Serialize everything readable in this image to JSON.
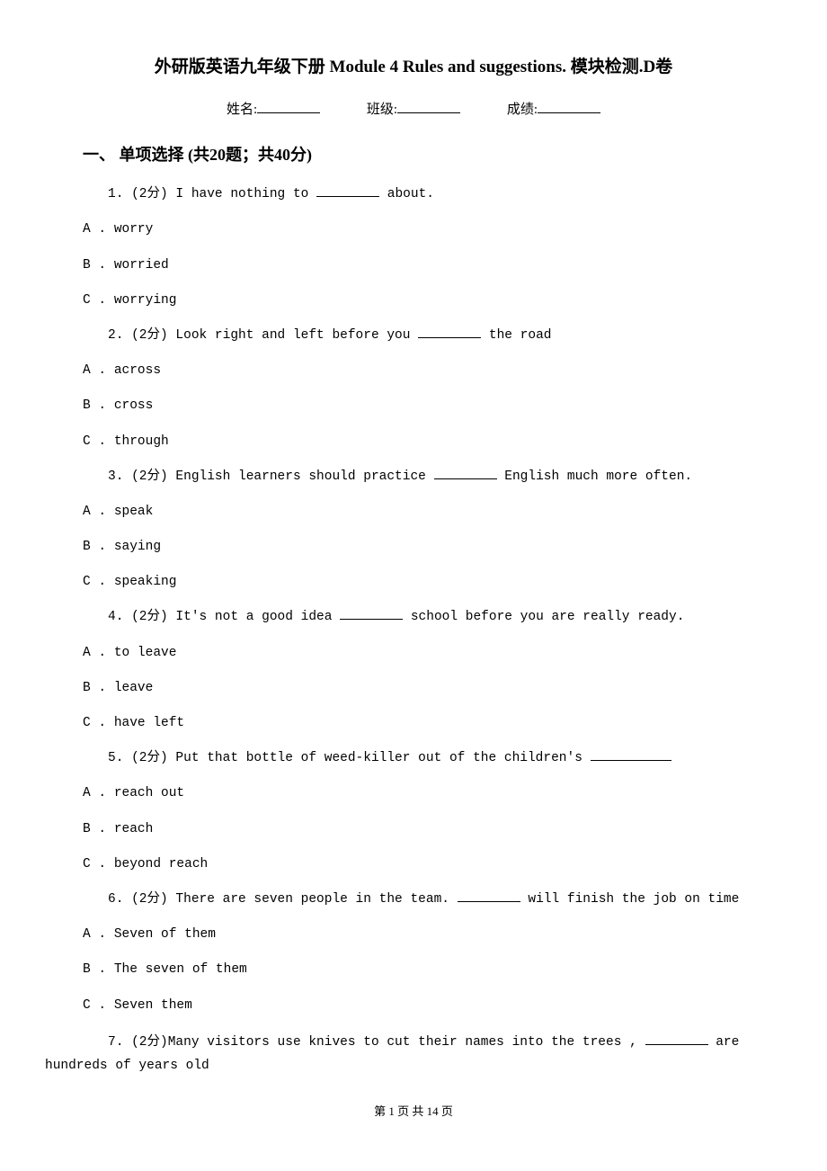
{
  "title": "外研版英语九年级下册 Module 4 Rules and suggestions. 模块检测.D卷",
  "info": {
    "name_label": "姓名:",
    "class_label": "班级:",
    "score_label": "成绩:"
  },
  "section": {
    "number": "一、",
    "title": "单项选择 (共20题；共40分)"
  },
  "questions": [
    {
      "num": "1.",
      "points": "(2分)",
      "stem_before": "I have nothing to ",
      "stem_after": " about.",
      "options": [
        {
          "letter": "A .",
          "text": "worry"
        },
        {
          "letter": "B .",
          "text": "worried"
        },
        {
          "letter": "C .",
          "text": "worrying"
        }
      ]
    },
    {
      "num": "2.",
      "points": "(2分)",
      "stem_before": "Look right and left before you ",
      "stem_after": " the road",
      "options": [
        {
          "letter": "A .",
          "text": "across"
        },
        {
          "letter": "B .",
          "text": "cross"
        },
        {
          "letter": "C .",
          "text": "through"
        }
      ]
    },
    {
      "num": "3.",
      "points": "(2分)",
      "stem_before": "English learners should practice ",
      "stem_after": " English much more often.",
      "options": [
        {
          "letter": "A .",
          "text": "speak"
        },
        {
          "letter": "B .",
          "text": "saying"
        },
        {
          "letter": "C .",
          "text": "speaking"
        }
      ]
    },
    {
      "num": "4.",
      "points": "(2分)",
      "stem_before": "It's  not a good idea ",
      "stem_after": " school before you are really ready.",
      "options": [
        {
          "letter": "A .",
          "text": "to leave"
        },
        {
          "letter": "B .",
          "text": "leave"
        },
        {
          "letter": "C .",
          "text": "have left"
        }
      ]
    },
    {
      "num": "5.",
      "points": "(2分)",
      "stem_before": "Put that bottle of weed-killer out of the children's ",
      "stem_after": "",
      "options": [
        {
          "letter": "A .",
          "text": "reach out"
        },
        {
          "letter": "B .",
          "text": "reach"
        },
        {
          "letter": "C .",
          "text": "beyond reach"
        }
      ]
    },
    {
      "num": "6.",
      "points": "(2分)",
      "stem_before": "There are seven people in the team. ",
      "stem_after": " will finish the job on time",
      "options": [
        {
          "letter": "A .",
          "text": "Seven of them"
        },
        {
          "letter": "B .",
          "text": "The seven of them"
        },
        {
          "letter": "C .",
          "text": "Seven them"
        }
      ]
    },
    {
      "num": "7.",
      "points": "(2分)",
      "stem_before": "Many visitors use knives to cut their names into the trees , ",
      "stem_after": " are hundreds of years old",
      "wrap": true,
      "options": []
    }
  ],
  "footer": "第 1 页 共 14 页"
}
